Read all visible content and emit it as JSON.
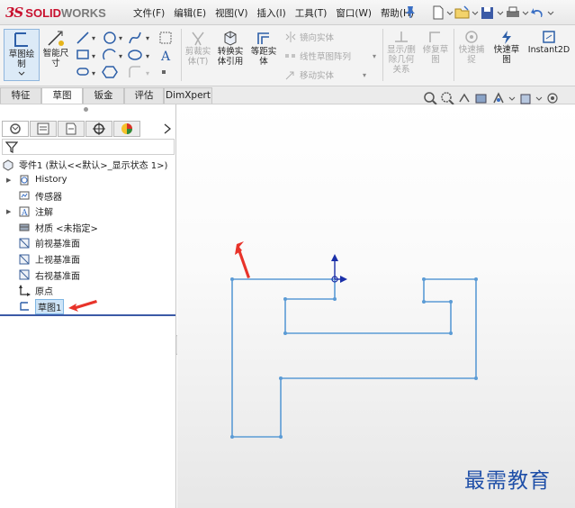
{
  "app": {
    "logo_ds": "3S",
    "logo_solid": "SOLID",
    "logo_works": "WORKS"
  },
  "menu": [
    "文件(F)",
    "编辑(E)",
    "视图(V)",
    "插入(I)",
    "工具(T)",
    "窗口(W)",
    "帮助(H)"
  ],
  "ribbon": {
    "sketch_label": "草图绘\n制",
    "smart_dim_label": "智能尺\n寸",
    "trim_label": "剪裁实\n体(T)",
    "convert_label": "转换实\n体引用",
    "offset_label": "等距实\n体",
    "mirror_label": "镜向实体",
    "linear_pattern_label": "线性草图阵列",
    "move_label": "移动实体",
    "show_relations_label": "显示/删\n除几何\n关系",
    "repair_label": "修复草\n图",
    "quick_snaps_label": "快速捕\n捉",
    "rapid_sketch_label": "快速草\n图",
    "instant2d_label": "Instant2D"
  },
  "tabs": [
    {
      "label": "特征",
      "active": false
    },
    {
      "label": "草图",
      "active": true
    },
    {
      "label": "钣金",
      "active": false
    },
    {
      "label": "评估",
      "active": false
    },
    {
      "label": "DimXpert",
      "active": false
    }
  ],
  "tree": {
    "root_label": "零件1 (默认<<默认>_显示状态 1>)",
    "items": [
      {
        "label": "History",
        "icon": "history-icon",
        "expandable": true
      },
      {
        "label": "传感器",
        "icon": "sensor-icon",
        "expandable": false
      },
      {
        "label": "注解",
        "icon": "annotation-icon",
        "expandable": true
      },
      {
        "label": "材质 <未指定>",
        "icon": "material-icon",
        "expandable": false
      },
      {
        "label": "前视基准面",
        "icon": "plane-icon",
        "expandable": false
      },
      {
        "label": "上视基准面",
        "icon": "plane-icon",
        "expandable": false
      },
      {
        "label": "右视基准面",
        "icon": "plane-icon",
        "expandable": false
      },
      {
        "label": "原点",
        "icon": "origin-icon",
        "expandable": false
      },
      {
        "label": "草图1",
        "icon": "sketch-icon",
        "expandable": false,
        "selected": true
      }
    ]
  },
  "colors": {
    "sketch_line": "#5b9bd5",
    "arrow": "#e8332a",
    "origin": "#1a2fa8",
    "watermark": "#1f4fa8"
  },
  "watermark": "最需教育"
}
